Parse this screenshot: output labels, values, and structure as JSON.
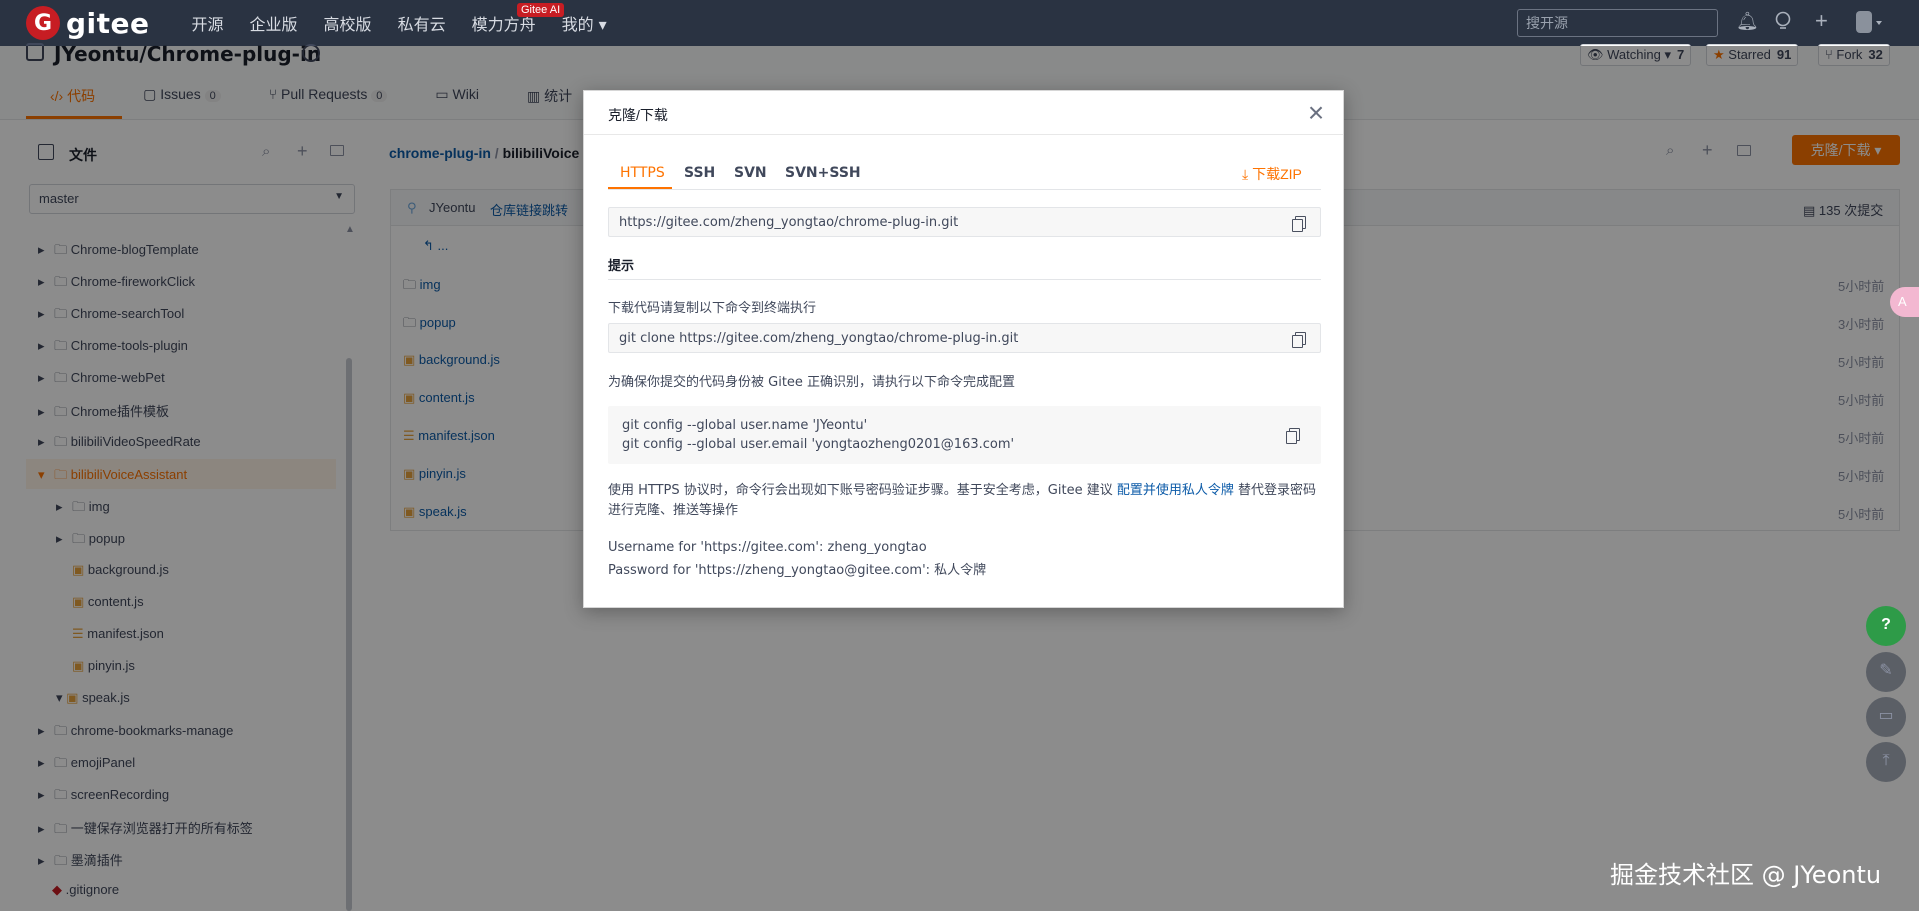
{
  "topnav": {
    "logo_letter": "G",
    "logo_text": "gitee",
    "links": [
      "开源",
      "企业版",
      "高校版",
      "私有云",
      "模力方舟",
      "我的 ▾"
    ],
    "ai_badge": "Gitee AI",
    "search_placeholder": "搜开源"
  },
  "repo": {
    "title": "JYeontu/Chrome-plug-in",
    "watching_label": "Watching ▾",
    "watching_count": "7",
    "starred_label": "Starred",
    "starred_count": "91",
    "fork_label": "Fork",
    "fork_count": "32",
    "tabs": [
      {
        "label": "‹/› 代码",
        "count": ""
      },
      {
        "label": "Issues",
        "count": "0"
      },
      {
        "label": "Pull Requests",
        "count": "0"
      },
      {
        "label": "Wiki",
        "count": ""
      },
      {
        "label": "统计",
        "count": ""
      }
    ]
  },
  "sidebar": {
    "title": "文件",
    "branch": "master",
    "items": [
      "Chrome-blogTemplate",
      "Chrome-fireworkClick",
      "Chrome-searchTool",
      "Chrome-tools-plugin",
      "Chrome-webPet",
      "Chrome插件模板",
      "bilibiliVideoSpeedRate",
      "bilibiliVoiceAssistant",
      "img",
      "popup",
      "background.js",
      "content.js",
      "manifest.json",
      "pinyin.js",
      "speak.js",
      "chrome-bookmarks-manage",
      "emojiPanel",
      "screenRecording",
      "一键保存浏览器打开的所有标签",
      "墨滴插件",
      ".gitignore"
    ]
  },
  "main": {
    "breadcrumb_repo": "chrome-plug-in",
    "breadcrumb_sep": "/",
    "breadcrumb_dir": "bilibiliVoice",
    "clone_button": "克隆/下载 ▾",
    "commit_author": "JYeontu",
    "commit_msg": "仓库链接跳转",
    "commit_count": "135 次提交",
    "back": "...",
    "files": [
      {
        "name": "img",
        "time": "5小时前"
      },
      {
        "name": "popup",
        "time": "3小时前"
      },
      {
        "name": "background.js",
        "time": "5小时前"
      },
      {
        "name": "content.js",
        "time": "5小时前"
      },
      {
        "name": "manifest.json",
        "time": "5小时前"
      },
      {
        "name": "pinyin.js",
        "time": "5小时前"
      },
      {
        "name": "speak.js",
        "time": "5小时前"
      }
    ]
  },
  "modal": {
    "title": "克隆/下载",
    "tabs": [
      "HTTPS",
      "SSH",
      "SVN",
      "SVN+SSH"
    ],
    "download_zip": "下载ZIP",
    "https_url": "https://gitee.com/zheng_yongtao/chrome-plug-in.git",
    "hint_title": "提示",
    "hint_desc": "下载代码请复制以下命令到终端执行",
    "clone_cmd": "git clone https://gitee.com/zheng_yongtao/chrome-plug-in.git",
    "config_desc": "为确保你提交的代码身份被 Gitee 正确识别，请执行以下命令完成配置",
    "config_cmd1": "git config --global user.name 'JYeontu'",
    "config_cmd2": "git config --global user.email 'yongtaozheng0201@163.com'",
    "https_note_pre": "使用 HTTPS 协议时，命令行会出现如下账号密码验证步骤。基于安全考虑，Gitee 建议 ",
    "https_note_link": "配置并使用私人令牌",
    "https_note_post": " 替代登录密码进行克隆、推送等操作",
    "username_line": "Username for 'https://gitee.com': zheng_yongtao",
    "password_line": "Password for 'https://zheng_yongtao@gitee.com': 私人令牌"
  },
  "watermark": "掘金技术社区 @ JYeontu",
  "colors": {
    "accent": "#fe7300",
    "nav_bg": "#2a3342",
    "link": "#0c5ba8"
  }
}
